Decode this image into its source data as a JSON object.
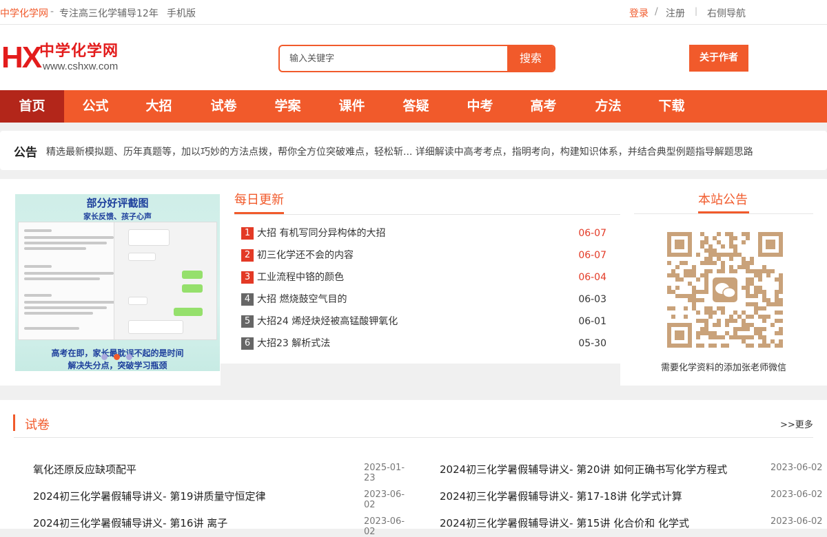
{
  "topbar": {
    "site_name": "中学化学网",
    "dash": "-",
    "slogan": "专注高三化学辅导12年",
    "mobile": "手机版",
    "login": "登录",
    "sep": "/",
    "register": "注册",
    "sep2": "|",
    "right_nav": "右侧导航"
  },
  "header": {
    "logo_mark": "HX",
    "logo_cn": "中学化学网",
    "logo_url": "www.cshxw.com",
    "search_placeholder": "输入关键字",
    "search_button": "搜索",
    "about_button": "关于作者"
  },
  "nav": {
    "items": [
      {
        "label": "首页"
      },
      {
        "label": "公式"
      },
      {
        "label": "大招"
      },
      {
        "label": "试卷"
      },
      {
        "label": "学案"
      },
      {
        "label": "课件"
      },
      {
        "label": "答疑"
      },
      {
        "label": "中考"
      },
      {
        "label": "高考"
      },
      {
        "label": "方法"
      },
      {
        "label": "下载"
      }
    ]
  },
  "notice": {
    "label": "公告",
    "text": "精选最新模拟题、历年真题等，加以巧妙的方法点拨，帮你全方位突破难点，轻松斩... 详细解读中高考考点，指明考向，构建知识体系，并结合典型例题指导解题思路"
  },
  "slide": {
    "title": "部分好评截图",
    "subtitle": "家长反馈、孩子心声",
    "footer_line1": "高考在即，家长最耽误不起的是时间",
    "footer_line2": "解决失分点，突破学习瓶颈"
  },
  "daily": {
    "heading": "每日更新",
    "items": [
      {
        "num": "1",
        "title": "大招 有机写同分异构体的大招",
        "date": "06-07"
      },
      {
        "num": "2",
        "title": "初三化学还不会的内容",
        "date": "06-07"
      },
      {
        "num": "3",
        "title": "工业流程中铬的颜色",
        "date": "06-04"
      },
      {
        "num": "4",
        "title": "大招 燃烧鼓空气目的",
        "date": "06-03"
      },
      {
        "num": "5",
        "title": "大招24 烯烃炔烃被高锰酸钾氧化",
        "date": "06-01"
      },
      {
        "num": "6",
        "title": "大招23 解析式法",
        "date": "05-30"
      }
    ]
  },
  "site_notice": {
    "heading": "本站公告",
    "caption": "需要化学资料的添加张老师微信"
  },
  "exam": {
    "heading": "试卷",
    "more": ">>更多",
    "left": [
      {
        "title": "氧化还原反应缺项配平",
        "date": "2025-01-23"
      },
      {
        "title": "2024初三化学暑假辅导讲义- 第19讲质量守恒定律",
        "date": "2023-06-02"
      },
      {
        "title": "2024初三化学暑假辅导讲义- 第16讲 离子",
        "date": "2023-06-02"
      }
    ],
    "right": [
      {
        "title": "2024初三化学暑假辅导讲义- 第20讲 如何正确书写化学方程式",
        "date": "2023-06-02"
      },
      {
        "title": "2024初三化学暑假辅导讲义- 第17-18讲 化学式计算",
        "date": "2023-06-02"
      },
      {
        "title": "2024初三化学暑假辅导讲义- 第15讲 化合价和 化学式",
        "date": "2023-06-02"
      }
    ]
  },
  "colors": {
    "accent": "#f15a2b",
    "nav_active": "#b3261a",
    "hot_rank": "#e33a26",
    "cold_rank": "#666666"
  }
}
